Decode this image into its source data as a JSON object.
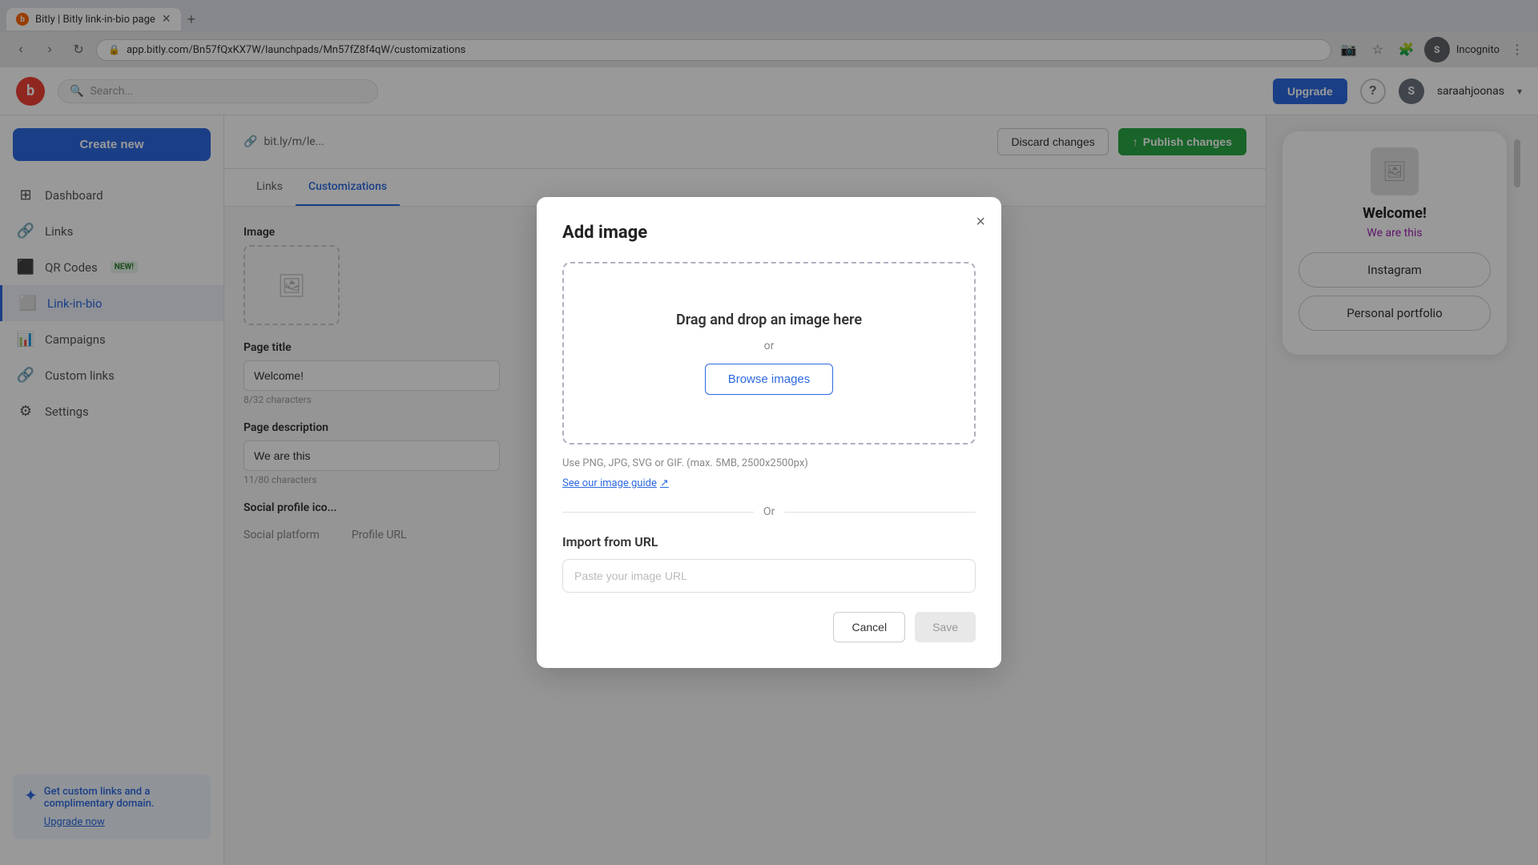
{
  "browser": {
    "tab_title": "Bitly | Bitly link-in-bio page",
    "url": "app.bitly.com/Bn57fQxKX7W/launchpads/Mn57fZ8f4qW/customizations",
    "favicon_letter": "b",
    "incognito_label": "Incognito",
    "user_profile_letter": "S"
  },
  "topnav": {
    "logo_letter": "b",
    "search_placeholder": "Search...",
    "upgrade_label": "Upgrade",
    "help_label": "?",
    "user_name": "saraahjoonas",
    "user_initial": "S"
  },
  "sidebar": {
    "create_new_label": "Create new",
    "nav_items": [
      {
        "id": "dashboard",
        "label": "Dashboard",
        "icon": "⊞"
      },
      {
        "id": "links",
        "label": "Links",
        "icon": "🔗"
      },
      {
        "id": "qr-codes",
        "label": "QR Codes",
        "icon": "⬛",
        "badge": "NEW!"
      },
      {
        "id": "link-in-bio",
        "label": "Link-in-bio",
        "icon": "⬜",
        "active": true
      },
      {
        "id": "campaigns",
        "label": "Campaigns",
        "icon": "📊"
      },
      {
        "id": "custom-links",
        "label": "Custom links",
        "icon": "🔗"
      },
      {
        "id": "settings",
        "label": "Settings",
        "icon": "⚙"
      }
    ],
    "promo": {
      "sparkle": "✦",
      "text": "Get custom links and a complimentary domain.",
      "link_label": "Upgrade now"
    }
  },
  "content_header": {
    "url_preview": "bit.ly/m/le...",
    "discard_label": "Discard changes",
    "publish_label": "Publish changes",
    "publish_icon": "↑"
  },
  "tabs": [
    {
      "id": "links",
      "label": "Links"
    },
    {
      "id": "customizations",
      "label": "Customizations",
      "active": true
    }
  ],
  "form": {
    "image_section_label": "Image",
    "page_title_label": "Page title",
    "page_title_value": "Welcome!",
    "page_title_chars": "8/32 characters",
    "page_desc_label": "Page description",
    "page_desc_value": "We are this",
    "page_desc_chars": "11/80 characters",
    "social_label": "Social profile ico...",
    "social_platform_col": "Social platform",
    "social_url_col": "Profile URL"
  },
  "preview": {
    "title": "Welcome!",
    "subtitle": "We are this",
    "buttons": [
      "Instagram",
      "Personal portfolio"
    ]
  },
  "modal": {
    "title": "Add image",
    "close_label": "×",
    "drop_text": "Drag and drop an image here",
    "drop_or": "or",
    "browse_label": "Browse images",
    "file_hint": "Use PNG, JPG, SVG or GIF. (max. 5MB, 2500x2500px)",
    "image_guide_label": "See our image guide",
    "divider_label": "Or",
    "import_label": "Import from URL",
    "url_placeholder": "Paste your image URL",
    "cancel_label": "Cancel",
    "save_label": "Save"
  }
}
